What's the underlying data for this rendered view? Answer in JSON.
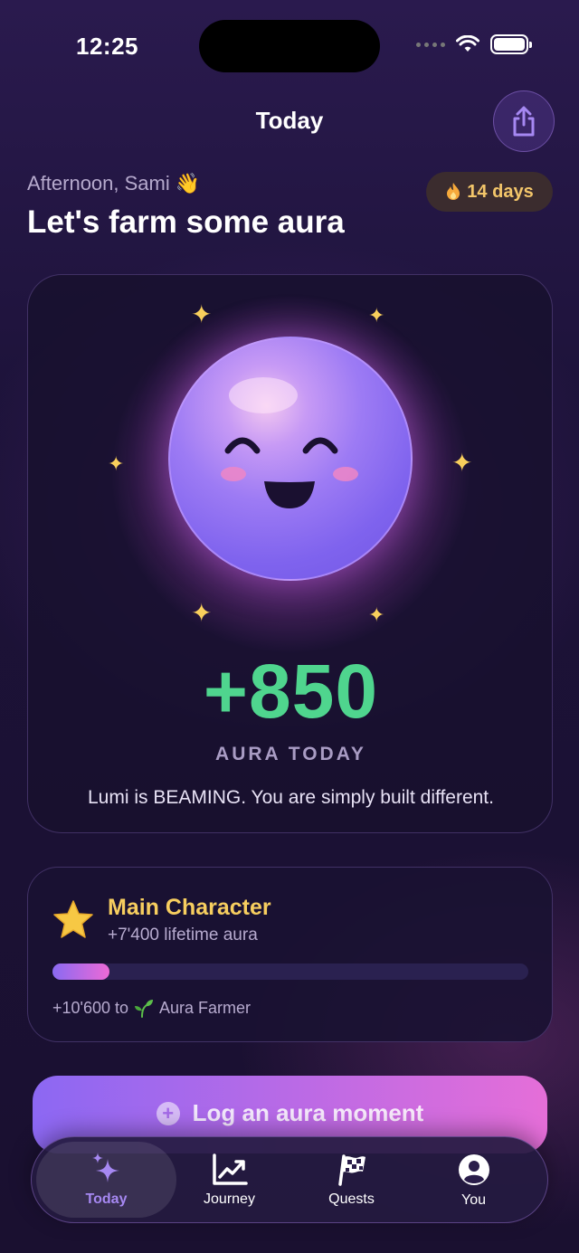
{
  "status": {
    "time": "12:25"
  },
  "nav": {
    "title": "Today",
    "share_icon": "share-icon"
  },
  "greeting": {
    "text": "Afternoon, Sami 👋",
    "headline": "Let's farm some aura"
  },
  "streak": {
    "icon": "fire-icon",
    "label": "14 days"
  },
  "hero": {
    "score": "+850",
    "score_label": "AURA TODAY",
    "message": "Lumi is BEAMING. You are simply built different."
  },
  "rank": {
    "icon": "star-icon",
    "title": "Main Character",
    "subtitle": "+7'400 lifetime aura",
    "progress_fraction": 0.12,
    "next_prefix": "+10'600 to",
    "next_icon": "seedling-icon",
    "next_rank": "Aura Farmer"
  },
  "cta": {
    "label": "Log an aura moment"
  },
  "tabs": [
    {
      "label": "Today",
      "icon": "sparkles-icon",
      "active": true
    },
    {
      "label": "Journey",
      "icon": "chart-icon",
      "active": false
    },
    {
      "label": "Quests",
      "icon": "flag-icon",
      "active": false
    },
    {
      "label": "You",
      "icon": "profile-icon",
      "active": false
    }
  ],
  "colors": {
    "accent": "#a688f2",
    "score": "#4fd58e",
    "gold": "#f7ce5f"
  }
}
